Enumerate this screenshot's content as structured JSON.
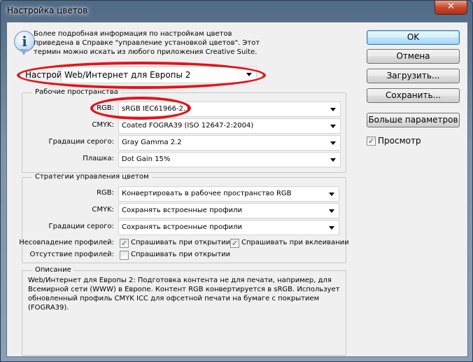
{
  "window": {
    "title": "Настройка цветов",
    "close_icon": "close-icon"
  },
  "info": {
    "icon": "info-icon",
    "lines": [
      "Более подробная информация по настройкам цветов",
      "приведена в Справке \"управление установкой цветов\". Этот",
      "термин можно искать из любого приложения Creative Suite."
    ]
  },
  "settings": {
    "label": "Настройки:",
    "value": "Web/Интернет для Европы 2"
  },
  "working_spaces": {
    "title": "Рабочие пространства",
    "rows": [
      {
        "label": "RGB:",
        "value": "sRGB IEC61966-2.1"
      },
      {
        "label": "CMYK:",
        "value": "Coated FOGRA39 (ISO 12647-2:2004)"
      },
      {
        "label": "Градации серого:",
        "value": "Gray Gamma 2.2"
      },
      {
        "label": "Плашка:",
        "value": "Dot Gain 15%"
      }
    ]
  },
  "policies": {
    "title": "Стратегии управления цветом",
    "rows": [
      {
        "label": "RGB:",
        "value": "Конвертировать в рабочее пространство RGB"
      },
      {
        "label": "CMYK:",
        "value": "Сохранять встроенные профили"
      },
      {
        "label": "Градации серого:",
        "value": "Сохранять встроенные профили"
      }
    ],
    "mismatch": {
      "label": "Несовпадение профилей:",
      "ask_open": {
        "label": "Спрашивать при открытии",
        "checked": true
      },
      "ask_paste": {
        "label": "Спрашивать при вклеивании",
        "checked": true
      }
    },
    "missing": {
      "label": "Отсутствие профилей:",
      "ask_open": {
        "label": "Спрашивать при открытии",
        "checked": false
      }
    }
  },
  "description": {
    "title": "Описание",
    "lines": [
      "Web/Интернет для Европы 2:  Подготовка контента не для печати, например, для",
      "Всемирной сети (WWW) в Европе. Контент RGB конвертируется в sRGB. Использует",
      "обновленный профиль CMYK ICC для офсетной печати на бумаге с покрытием (FOGRA39)."
    ]
  },
  "buttons": {
    "ok": "OK",
    "cancel": "Отмена",
    "load": "Загрузить...",
    "save": "Сохранить...",
    "more": "Больше параметров"
  },
  "preview": {
    "label": "Просмотр",
    "checked": true
  },
  "colors": {
    "highlight": "#e3141b",
    "default_button": "#3c7fb1"
  }
}
